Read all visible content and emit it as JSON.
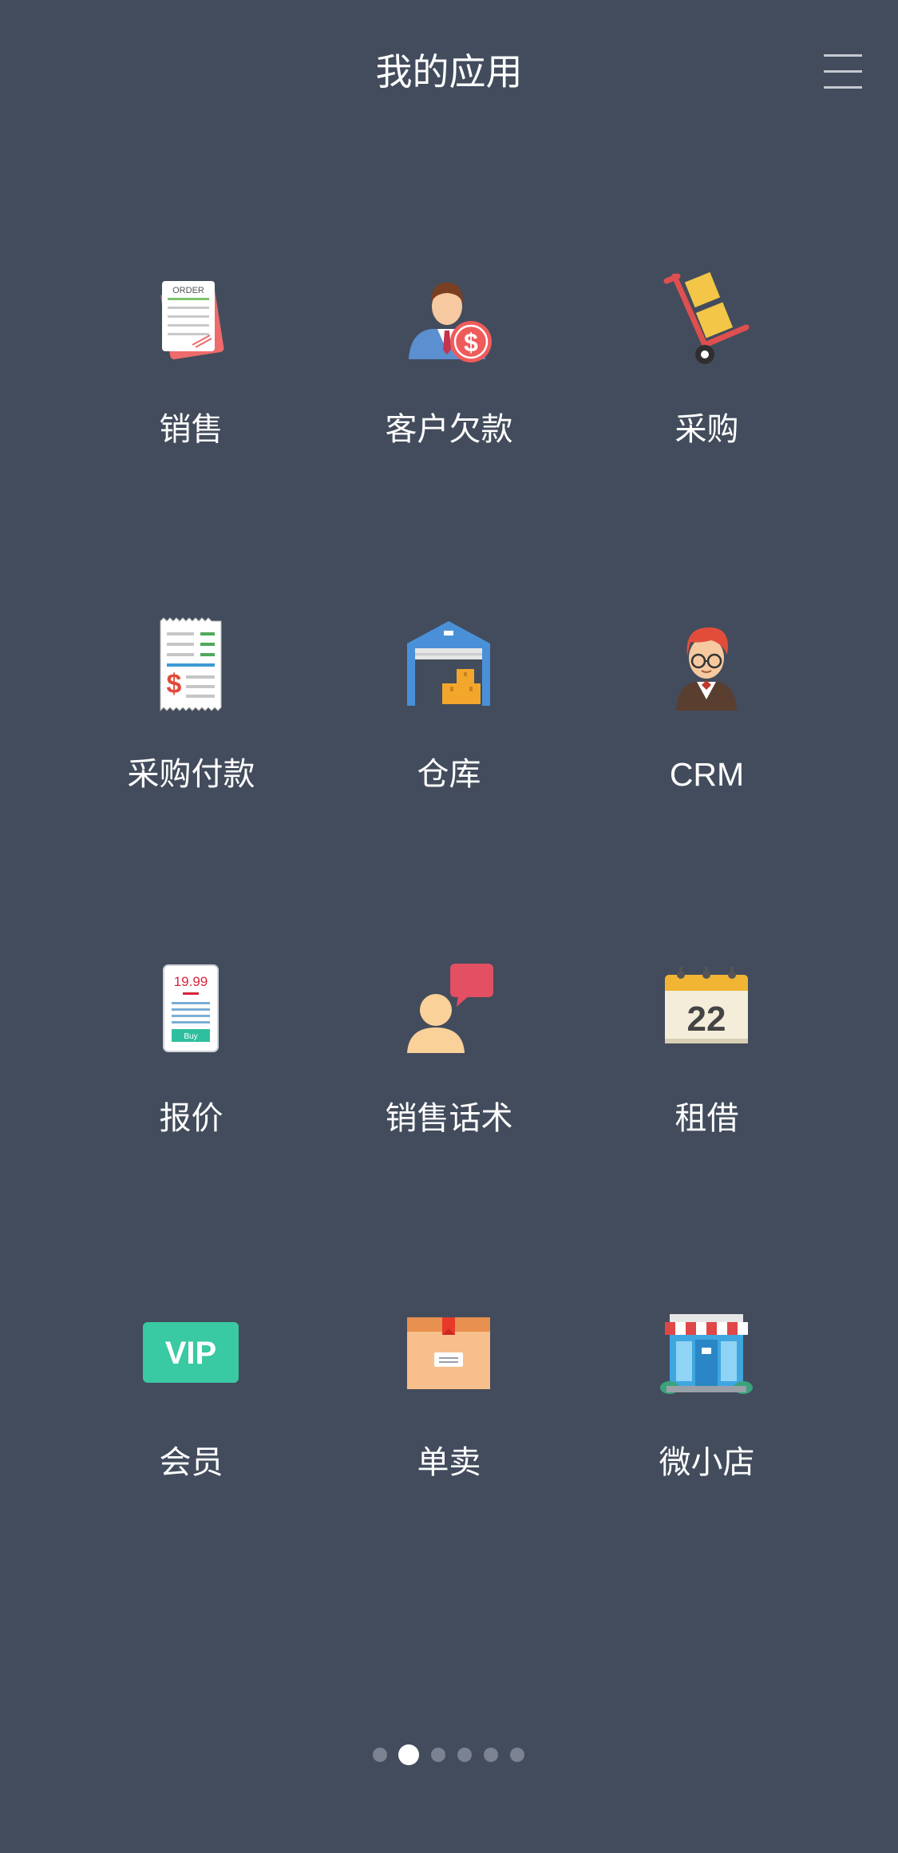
{
  "header": {
    "title": "我的应用",
    "menu_icon": "hamburger-menu-icon"
  },
  "apps": [
    {
      "label": "销售",
      "icon": "order-document-icon"
    },
    {
      "label": "客户欠款",
      "icon": "businessman-dollar-icon"
    },
    {
      "label": "采购",
      "icon": "hand-truck-boxes-icon"
    },
    {
      "label": "采购付款",
      "icon": "payment-receipt-icon"
    },
    {
      "label": "仓库",
      "icon": "warehouse-icon"
    },
    {
      "label": "CRM",
      "icon": "red-hair-person-icon"
    },
    {
      "label": "报价",
      "icon": "price-tag-receipt-icon",
      "icon_text": {
        "price": "19.99",
        "button": "Buy"
      }
    },
    {
      "label": "销售话术",
      "icon": "person-speech-bubble-icon"
    },
    {
      "label": "租借",
      "icon": "calendar-icon",
      "icon_text": {
        "day": "22"
      }
    },
    {
      "label": "会员",
      "icon": "vip-badge-icon",
      "icon_text": {
        "badge": "VIP"
      }
    },
    {
      "label": "单卖",
      "icon": "package-box-icon"
    },
    {
      "label": "微小店",
      "icon": "storefront-icon"
    }
  ],
  "pagination": {
    "total_pages": 6,
    "current_page": 2
  },
  "colors": {
    "background": "#434c5c",
    "text": "#ffffff",
    "dot_inactive": "#7b8291",
    "dot_active": "#ffffff"
  }
}
